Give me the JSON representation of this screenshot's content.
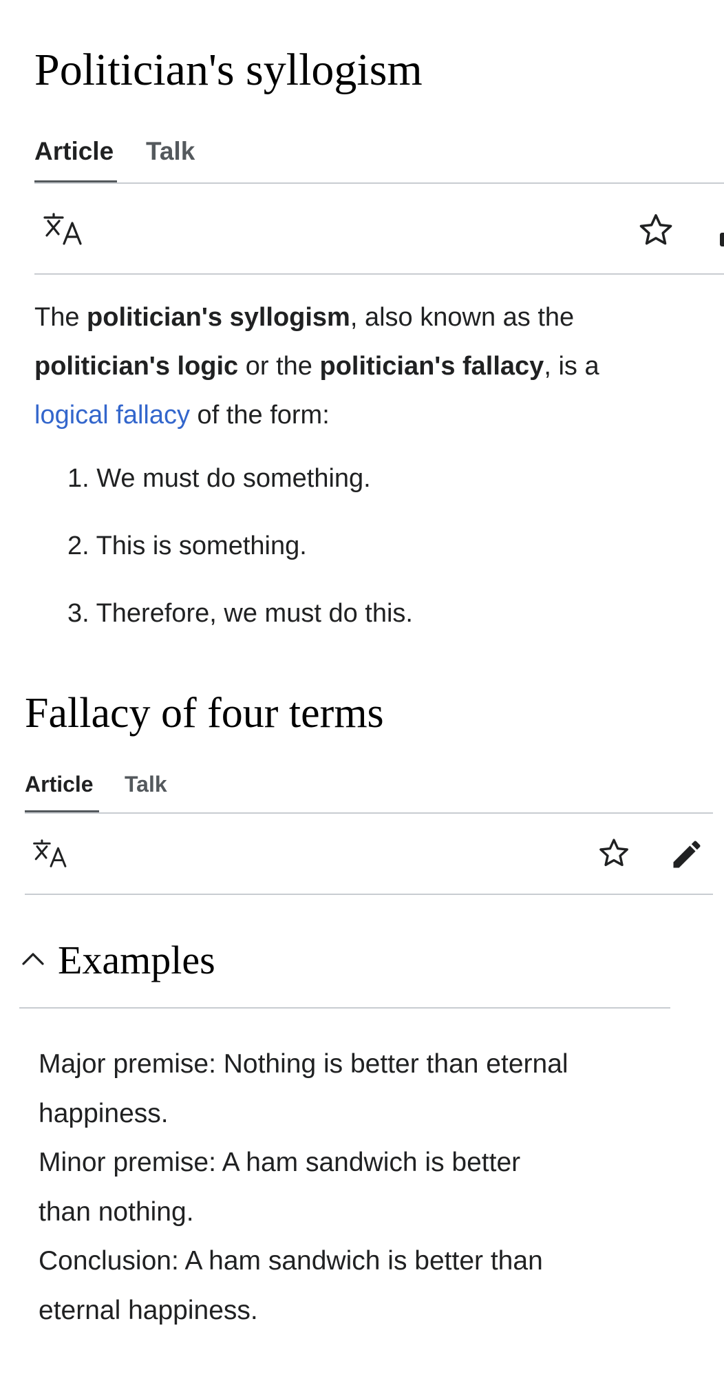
{
  "article1": {
    "title": "Politician's syllogism",
    "tabs": [
      "Article",
      "Talk"
    ],
    "icons": [
      "translate-icon",
      "star-icon"
    ],
    "intro": {
      "t1": "The ",
      "b1": "politician's syllogism",
      "t2": ", also known as the",
      "b2": "politician's logic",
      "t3": " or the ",
      "b3": "politician's fallacy",
      "t4": ", is a",
      "link": "logical fallacy",
      "t5": " of the form:"
    },
    "steps": [
      "1. We must do something.",
      "2. This is something.",
      "3. Therefore, we must do this."
    ]
  },
  "article2": {
    "title": "Fallacy of four terms",
    "tabs": [
      "Article",
      "Talk"
    ],
    "icons": [
      "translate-icon",
      "star-icon",
      "edit-icon"
    ],
    "section": {
      "heading": "Examples",
      "collapse_icon": "chevron-up-icon"
    },
    "example_lines": [
      "Major premise: Nothing is better than eternal",
      "happiness.",
      "Minor premise: A ham sandwich is better",
      "than nothing.",
      "Conclusion: A ham sandwich is better than",
      "eternal happiness."
    ]
  },
  "colors": {
    "link": "#3366cc",
    "text": "#202122",
    "tab_inactive": "#54595d",
    "divider": "#c8ccd1"
  }
}
